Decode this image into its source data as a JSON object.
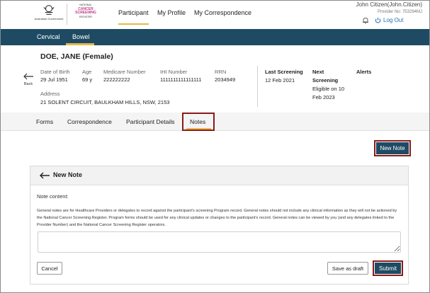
{
  "header": {
    "gov_text": "Australian Government",
    "logo_lines": [
      "NATIONAL",
      "CANCER",
      "SCREENING",
      "REGISTER"
    ],
    "nav": [
      {
        "label": "Participant"
      },
      {
        "label": "My Profile"
      },
      {
        "label": "My Correspondence"
      }
    ],
    "user_name": "John Citizen(John.Citizen)",
    "provider_no": "Provider No: 753294MJ",
    "logout_label": "Log Out"
  },
  "program_tabs": [
    "Cervical",
    "Bowel"
  ],
  "participant": {
    "name": "DOE, JANE (Female)",
    "back_label": "Back",
    "fields": {
      "dob_label": "Date of Birth",
      "dob_value": "29 Jul 1951",
      "age_label": "Age",
      "age_value": "69 y",
      "medicare_label": "Medicare Number",
      "medicare_value": "222222222",
      "ihi_label": "IHI Number",
      "ihi_value": "1111111111111111",
      "rrn_label": "RRN",
      "rrn_value": "2034949",
      "address_label": "Address",
      "address_value": "21 SOLENT CIRCUIT, BAULKHAM HILLS, NSW, 2153"
    },
    "last_screening_label": "Last Screening",
    "last_screening_value": "12 Feb 2021",
    "next_screening_label_1": "Next",
    "next_screening_label_2": "Screening",
    "next_screening_value_1": "Eligible on 10",
    "next_screening_value_2": "Feb 2023",
    "alerts_label": "Alerts"
  },
  "participant_tabs": [
    "Forms",
    "Correspondence",
    "Participant Details",
    "Notes"
  ],
  "new_note_button": "New Note",
  "note_panel": {
    "title": "New Note",
    "content_label": "Note content:",
    "description": "General notes are for Healthcare Providers or delegates to record against the participant's screening Program record. General notes should not include any clinical information as they will not be actioned by the National Cancer Screening Register. Program forms should be used for any clinical updates or changes to the participant's record. General notes can be viewed by you (and any delegates linked to the Provider Number) and the National Cancer Screening Register operators.",
    "textarea_value": "",
    "cancel_label": "Cancel",
    "save_draft_label": "Save as draft",
    "submit_label": "Submit"
  },
  "colors": {
    "primary": "#1e4b63",
    "accent": "#e8b74a",
    "highlight": "#8b1a1a",
    "link": "#1f6fb8"
  }
}
